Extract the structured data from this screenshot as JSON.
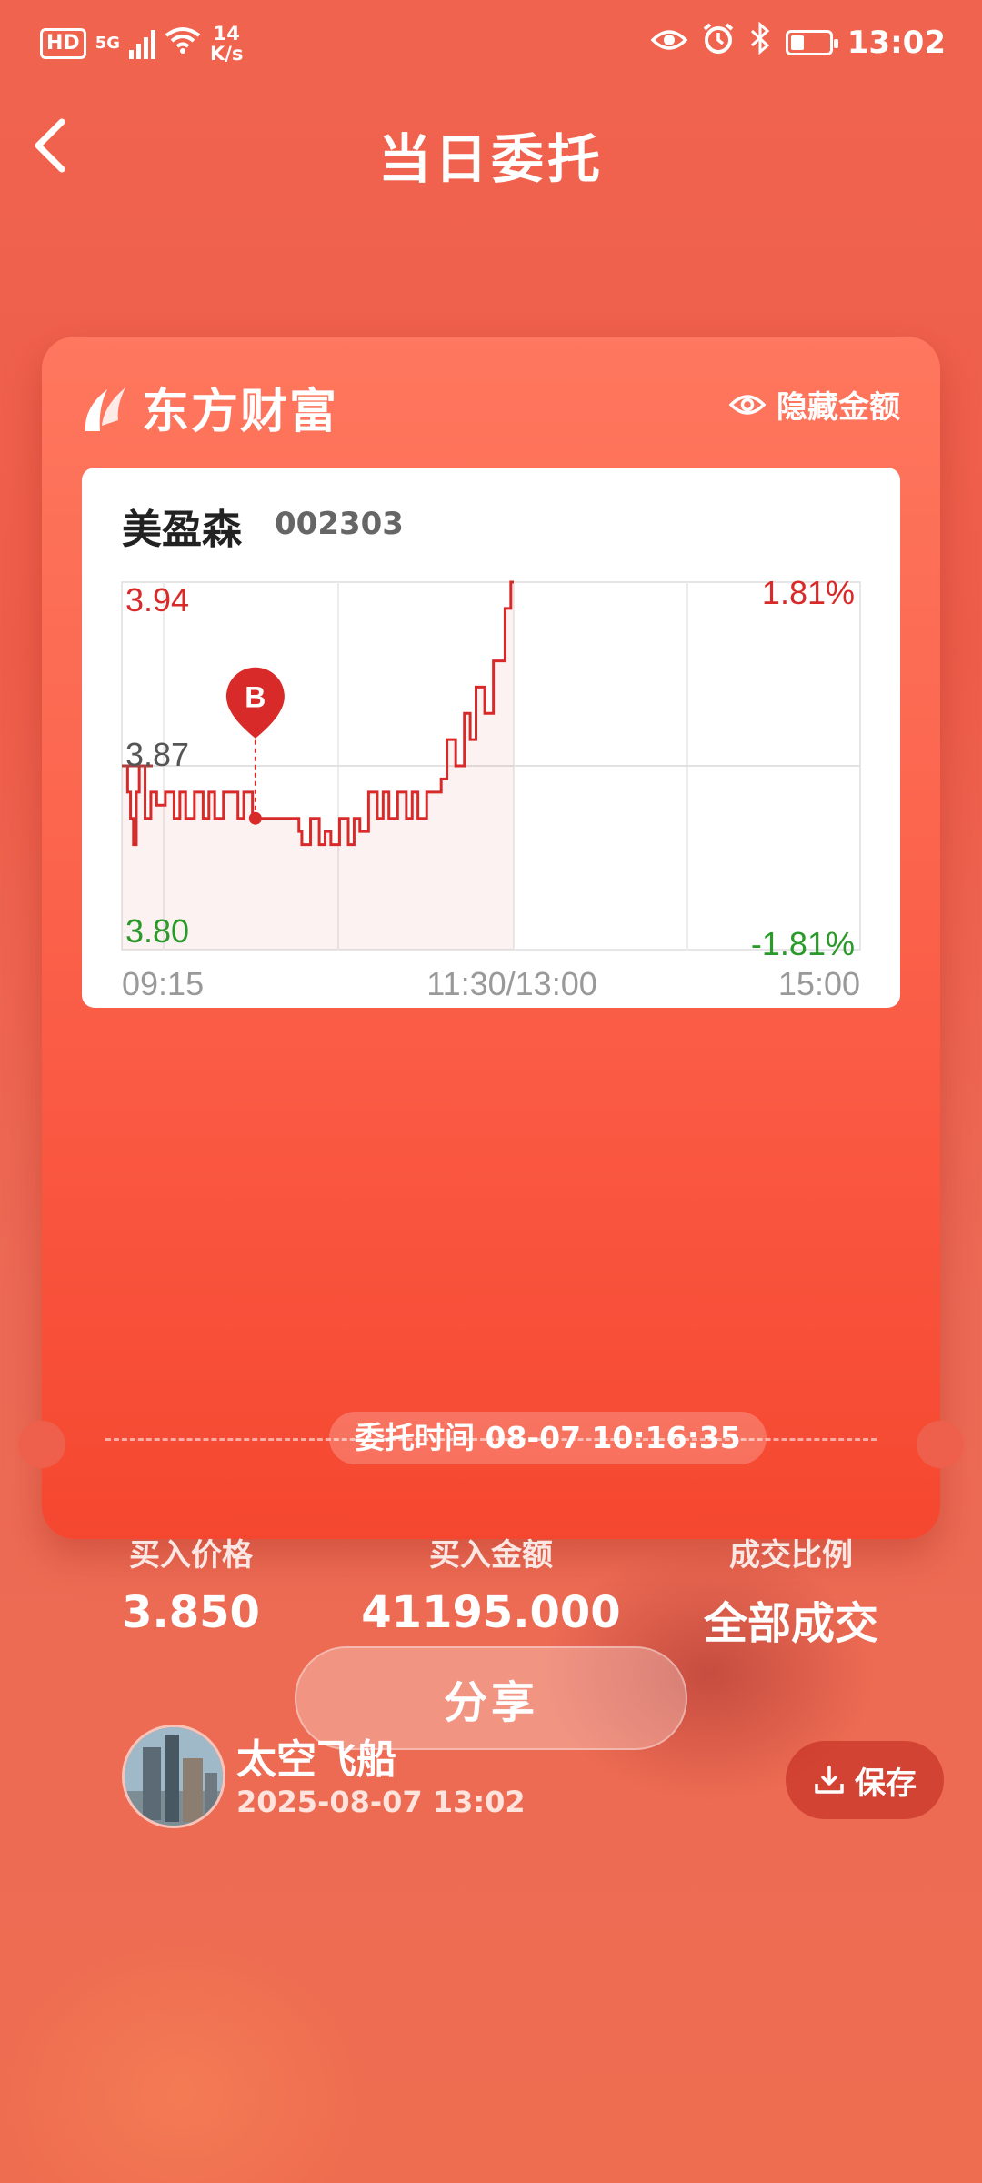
{
  "status_bar": {
    "hd": "HD",
    "network": "5G",
    "speed_value": "14",
    "speed_unit": "K/s",
    "battery_level": 0.35,
    "time": "13:02"
  },
  "header": {
    "title": "当日委托"
  },
  "card": {
    "brand": "东方财富",
    "hide_amount": "隐藏金额",
    "stock": {
      "name": "美盈森",
      "code": "002303"
    },
    "order_time": "委托时间 08-07 10:16:35",
    "stats": [
      {
        "label": "买入价格",
        "value": "3.850"
      },
      {
        "label": "买入金额",
        "value": "41195.000"
      },
      {
        "label": "成交比例",
        "value": "全部成交"
      }
    ],
    "user": {
      "name": "太空飞船",
      "time": "2025-08-07 13:02"
    },
    "save_label": "保存"
  },
  "share_label": "分享",
  "colors": {
    "up": "#d92a2a",
    "down": "#2a9a2a",
    "brand_red": "#f5472f"
  },
  "icons": [
    "back-icon",
    "eye-icon",
    "download-icon",
    "brand-logo-icon",
    "wifi-icon",
    "eye-status-icon",
    "alarm-icon",
    "bluetooth-icon",
    "battery-icon"
  ],
  "chart_data": {
    "type": "line",
    "price_top": "3.94",
    "price_mid": "3.87",
    "price_bottom": "3.80",
    "pct_top": "1.81%",
    "pct_bottom": "-1.81%",
    "time_start": "09:15",
    "time_mid": "11:30/13:00",
    "time_end": "15:00",
    "marker_label": "B",
    "ylim": [
      3.8,
      3.94
    ],
    "reference_price": 3.87,
    "x_minutes": [
      0,
      1,
      2,
      3,
      4,
      5,
      6,
      8,
      10,
      12,
      15,
      18,
      20,
      22,
      25,
      28,
      30,
      32,
      35,
      38,
      40,
      42,
      45,
      48,
      50,
      52,
      55,
      58,
      60,
      61,
      62,
      65,
      68,
      70,
      72,
      75,
      78,
      80,
      82,
      85,
      88,
      90,
      92,
      95,
      98,
      100,
      102,
      105,
      108,
      110,
      112,
      115,
      118,
      120,
      122,
      125,
      128,
      130,
      132,
      134,
      135
    ],
    "values": [
      3.87,
      3.87,
      3.86,
      3.85,
      3.84,
      3.86,
      3.87,
      3.85,
      3.86,
      3.855,
      3.86,
      3.85,
      3.86,
      3.85,
      3.86,
      3.85,
      3.86,
      3.85,
      3.86,
      3.86,
      3.85,
      3.86,
      3.85,
      3.85,
      3.85,
      3.85,
      3.85,
      3.85,
      3.85,
      3.845,
      3.84,
      3.85,
      3.84,
      3.845,
      3.84,
      3.85,
      3.84,
      3.85,
      3.845,
      3.86,
      3.85,
      3.86,
      3.85,
      3.86,
      3.85,
      3.86,
      3.85,
      3.86,
      3.86,
      3.865,
      3.88,
      3.87,
      3.89,
      3.88,
      3.9,
      3.89,
      3.91,
      3.91,
      3.93,
      3.94,
      3.94
    ],
    "buy_marker": {
      "minute": 46,
      "price": 3.85
    }
  }
}
